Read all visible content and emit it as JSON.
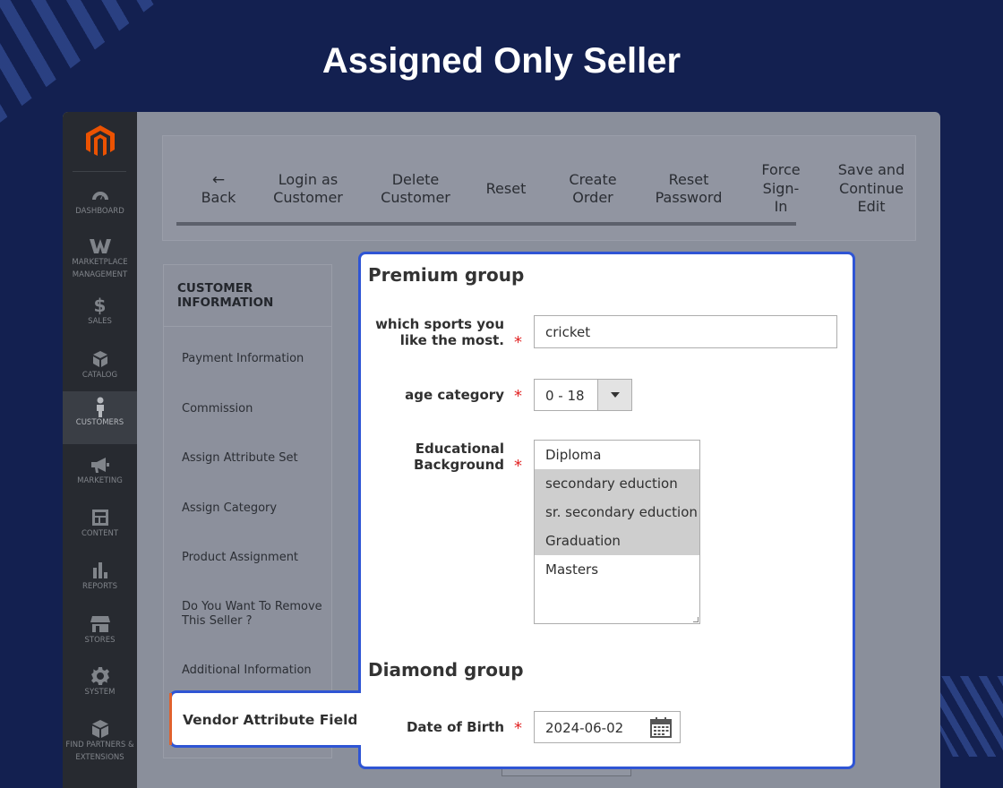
{
  "headline": "Assigned Only Seller",
  "sidebar": {
    "items": [
      {
        "label": "DASHBOARD",
        "icon": "dashboard-icon"
      },
      {
        "label": "MARKETPLACE MANAGEMENT",
        "icon": "marketplace-icon"
      },
      {
        "label": "SALES",
        "icon": "dollar-icon"
      },
      {
        "label": "CATALOG",
        "icon": "box-icon"
      },
      {
        "label": "CUSTOMERS",
        "icon": "person-icon",
        "active": true
      },
      {
        "label": "MARKETING",
        "icon": "megaphone-icon"
      },
      {
        "label": "CONTENT",
        "icon": "layout-icon"
      },
      {
        "label": "REPORTS",
        "icon": "bar-chart-icon"
      },
      {
        "label": "STORES",
        "icon": "store-icon"
      },
      {
        "label": "SYSTEM",
        "icon": "gear-icon"
      },
      {
        "label": "FIND PARTNERS & EXTENSIONS",
        "icon": "cube-icon"
      }
    ]
  },
  "toolbar": {
    "back": "Back",
    "login_as": "Login as",
    "customer_1": "Customer",
    "delete": "Delete",
    "customer_2": "Customer",
    "reset": "Reset",
    "create": "Create",
    "order": "Order",
    "reset_2": "Reset",
    "password": "Password",
    "force": "Force",
    "sign": "Sign-",
    "in": "In",
    "save_and": "Save and",
    "continue": "Continue",
    "edit": "Edit"
  },
  "tabs": {
    "heading_1": "CUSTOMER",
    "heading_2": "INFORMATION",
    "items": [
      "Payment Information",
      "Commission",
      "Assign Attribute Set",
      "Assign Category",
      "Product Assignment",
      "Do You Want To Remove",
      "This Seller ?",
      "Additional Information"
    ],
    "active": "Vendor Attribute Fields"
  },
  "form": {
    "premium_group": "Premium group",
    "sports_label_1": "which sports you",
    "sports_label_2": "like the most.",
    "sports_value": "cricket",
    "age_label": "age category",
    "age_value": "0 - 18",
    "edu_label_1": "Educational",
    "edu_label_2": "Background",
    "edu_options": [
      {
        "label": "Diploma",
        "selected": false
      },
      {
        "label": "secondary eduction",
        "selected": true
      },
      {
        "label": "sr. secondary eduction",
        "selected": true
      },
      {
        "label": "Graduation",
        "selected": true
      },
      {
        "label": "Masters",
        "selected": false
      }
    ],
    "diamond_group": "Diamond group",
    "dob_label": "Date of Birth",
    "dob_value": "2024-06-02",
    "required_mark": "*"
  },
  "colors": {
    "background": "#132050",
    "highlight_border": "#2f55d4",
    "active_tab_accent": "#e0612d",
    "required": "#e22626"
  }
}
